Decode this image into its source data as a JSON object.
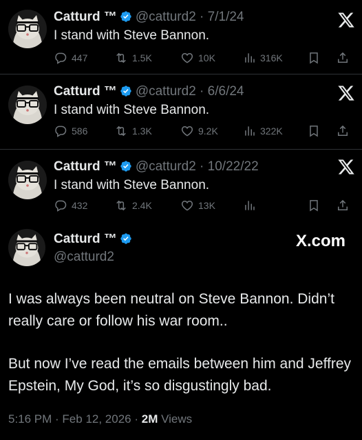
{
  "colors": {
    "background": "#000000",
    "text": "#e7e9ea",
    "muted": "#71767b",
    "verified": "#1d9bf0",
    "divider": "#2f3336"
  },
  "tweets": [
    {
      "name": "Catturd ™",
      "handle": "@catturd2",
      "date": "7/1/24",
      "text": "I stand with Steve Bannon.",
      "replies": "447",
      "reposts": "1.5K",
      "likes": "10K",
      "views": "316K"
    },
    {
      "name": "Catturd ™",
      "handle": "@catturd2",
      "date": "6/6/24",
      "text": "I stand with Steve Bannon.",
      "replies": "586",
      "reposts": "1.3K",
      "likes": "9.2K",
      "views": "322K"
    },
    {
      "name": "Catturd ™",
      "handle": "@catturd2",
      "date": "10/22/22",
      "text": "I stand with Steve Bannon.",
      "replies": "432",
      "reposts": "2.4K",
      "likes": "13K",
      "views": ""
    }
  ],
  "main_post": {
    "name": "Catturd ™",
    "handle": "@catturd2",
    "watermark": "X.com",
    "paragraph1": "I was always been neutral on Steve Bannon. Didn’t really care or follow his war room..",
    "paragraph2": "But now I’ve read the emails between him and Jeffrey Epstein, My God, it’s so disgustingly bad.",
    "time": "5:16 PM",
    "date": "Feb 12, 2026",
    "views_count": "2M",
    "views_label": "Views"
  }
}
